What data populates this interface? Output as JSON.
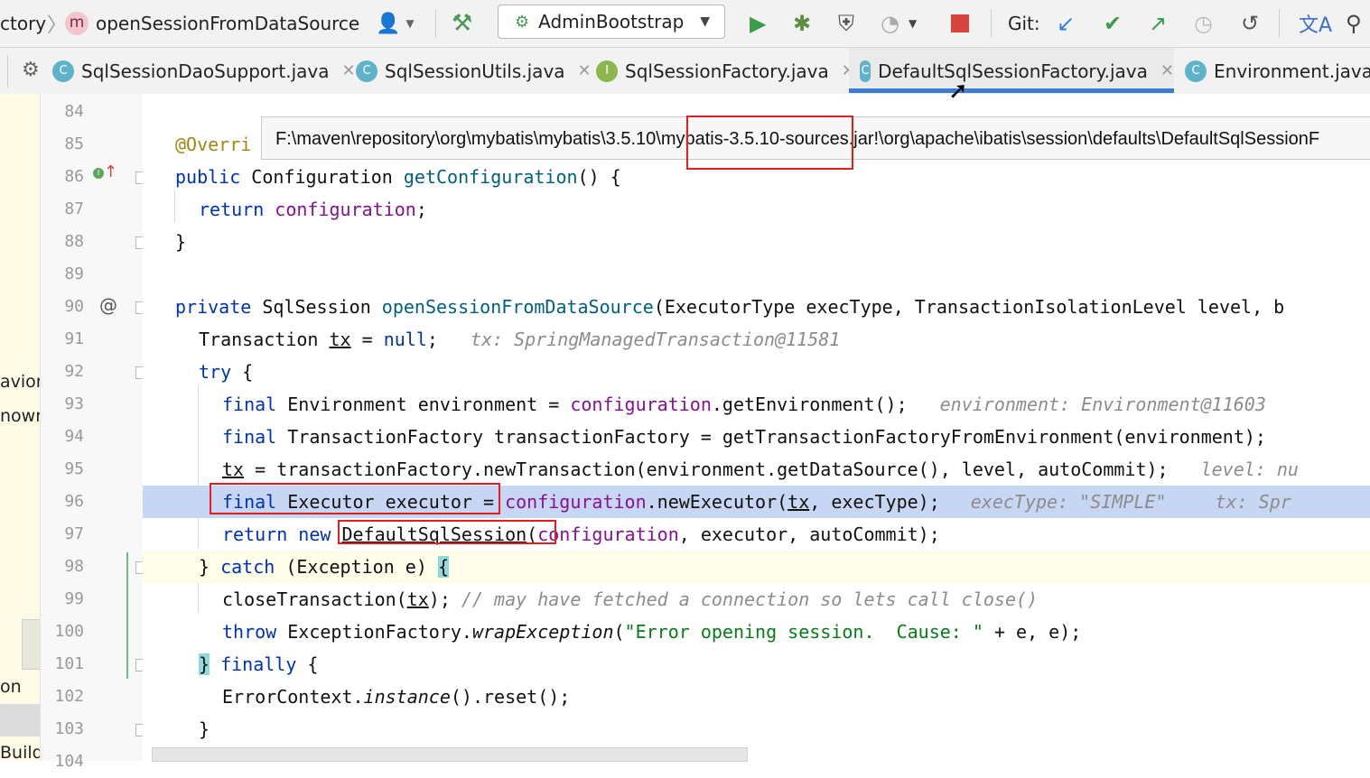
{
  "breadcrumb": {
    "class_partial": "ctory",
    "separator": "〉",
    "method_icon_letter": "m",
    "method": "openSessionFromDataSource"
  },
  "toolbar": {
    "run_config": "AdminBootstrap",
    "git_label": "Git:",
    "icons": [
      "user-icon",
      "build-hammer-icon",
      "run-icon",
      "debug-icon",
      "coverage-icon",
      "profile-icon",
      "stop-icon",
      "git-update-icon",
      "git-commit-icon",
      "git-push-icon",
      "history-icon",
      "rollback-icon",
      "translate-icon",
      "search-icon"
    ]
  },
  "tabs": [
    {
      "icon": "C",
      "label": "SqlSessionDaoSupport.java",
      "closable": true
    },
    {
      "icon": "C",
      "label": "SqlSessionUtils.java",
      "closable": true
    },
    {
      "icon": "I",
      "label": "SqlSessionFactory.java",
      "closable": true
    },
    {
      "icon": "C",
      "label": "DefaultSqlSessionFactory.java",
      "closable": true,
      "active": true
    },
    {
      "icon": "C",
      "label": "Environment.java",
      "closable": false
    }
  ],
  "tab_close_glyph": "✕",
  "left_strip": [
    "avior",
    "nowr",
    "on",
    "Build"
  ],
  "tooltip_path": "F:\\maven\\repository\\org\\mybatis\\mybatis\\3.5.10\\mybatis-3.5.10-sources.jar!\\org\\apache\\ibatis\\session\\defaults\\DefaultSqlSessionF",
  "line_numbers": [
    "84",
    "85",
    "86",
    "87",
    "88",
    "89",
    "90",
    "91",
    "92",
    "93",
    "94",
    "95",
    "96",
    "97",
    "98",
    "99",
    "100",
    "101",
    "102",
    "103",
    "104"
  ],
  "code": {
    "l85_ann": "@Overri",
    "l86_kw": "public ",
    "l86_type": "Configuration ",
    "l86_fn": "getConfiguration",
    "l86_rest": "() {",
    "l87_kw": "return ",
    "l87_fld": "configuration",
    "l87_rest": ";",
    "l88": "}",
    "l90_kw": "private ",
    "l90_type": "SqlSession ",
    "l90_fn": "openSessionFromDataSource",
    "l90_rest": "(ExecutorType execType, TransactionIsolationLevel level, b",
    "l91_a": "Transaction ",
    "l91_var": "tx",
    "l91_b": " = ",
    "l91_kw": "null",
    "l91_c": ";",
    "l91_hint": "tx: SpringManagedTransaction@11581",
    "l92_kw": "try",
    "l92_rest": " {",
    "l93_kw": "final ",
    "l93_a": "Environment environment = ",
    "l93_fld": "configuration",
    "l93_b": ".getEnvironment();",
    "l93_hint": "environment: Environment@11603",
    "l94_kw": "final ",
    "l94_a": "TransactionFactory transactionFactory = getTransactionFactoryFromEnvironment(environment);",
    "l95_var": "tx",
    "l95_a": " = transactionFactory.newTransaction(environment.getDataSource(), level, autoCommit);",
    "l95_hint": "level: nu",
    "l96_kw": "final ",
    "l96_a": "Executor executor",
    "l96_b": " = ",
    "l96_fld": "configuration",
    "l96_c": ".newExecutor(",
    "l96_var": "tx",
    "l96_d": ", execType);",
    "l96_hint1": "execType: \"SIMPLE\"",
    "l96_hint2": "tx: Spr",
    "l97_kw": "return new ",
    "l97_cls": "DefaultSqlSession",
    "l97_a": "(",
    "l97_fld": "configuration",
    "l97_b": ", executor, autoCommit);",
    "l98_a": "} ",
    "l98_kw": "catch",
    "l98_b": " (Exception e) ",
    "l98_brace": "{",
    "l99_a": "closeTransaction(",
    "l99_var": "tx",
    "l99_b": "); ",
    "l99_cmt": "// may have fetched a connection so lets call close()",
    "l100_kw": "throw ",
    "l100_a": "ExceptionFactory.",
    "l100_it": "wrapException",
    "l100_b": "(",
    "l100_str": "\"Error opening session.  Cause: \"",
    "l100_c": " + e, e);",
    "l101_brace": "}",
    "l101_kw": " finally",
    "l101_rest": " {",
    "l102_a": "ErrorContext.",
    "l102_it": "instance",
    "l102_b": "().reset();",
    "l103": "}",
    "l104": "}"
  },
  "colors": {
    "keyword": "#0033b3",
    "method_decl": "#00627a",
    "field": "#871094",
    "string": "#067d17",
    "comment": "#8c8c8c",
    "execution_line_bg": "#c7d6f2",
    "annotation_box": "#e02020"
  }
}
